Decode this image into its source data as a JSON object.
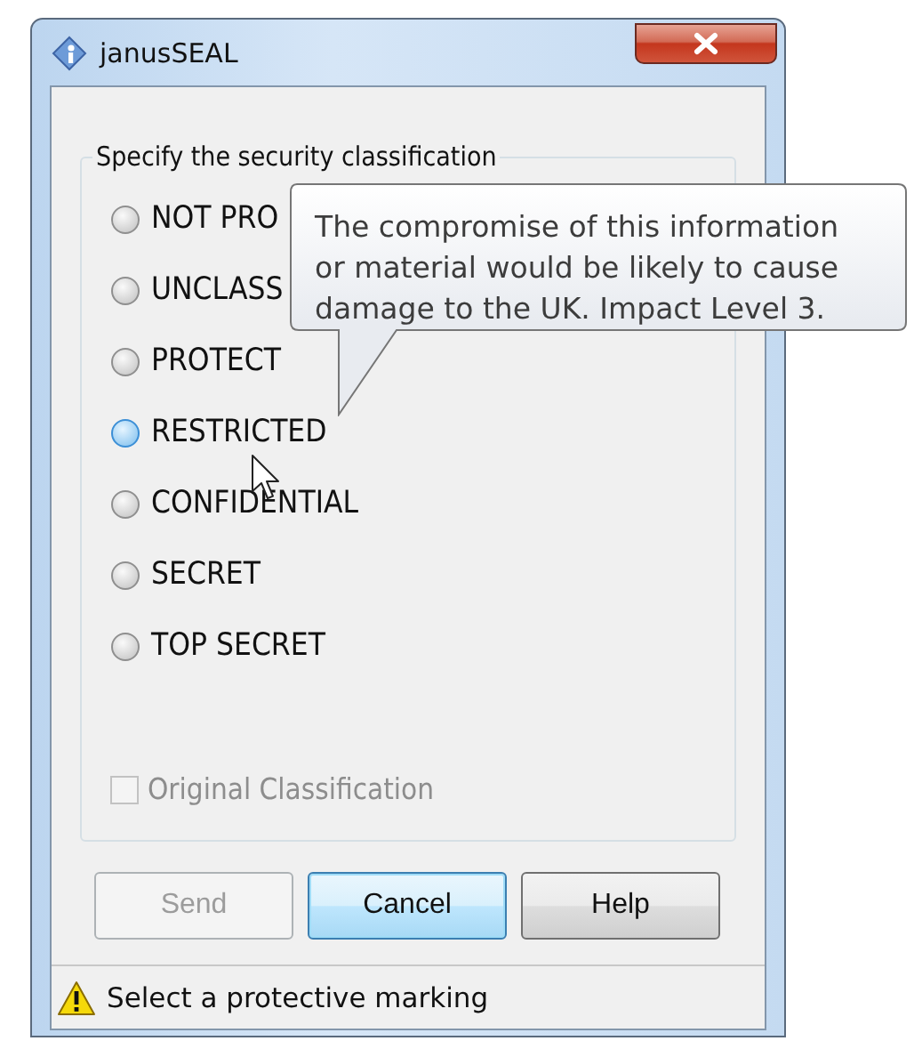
{
  "window": {
    "title": "janusSEAL"
  },
  "group": {
    "label": "Specify the security classification",
    "options": [
      {
        "label": "NOT PRO",
        "selected": false,
        "hovered": false
      },
      {
        "label": "UNCLASS",
        "selected": false,
        "hovered": false
      },
      {
        "label": "PROTECT",
        "selected": false,
        "hovered": false
      },
      {
        "label": "RESTRICTED",
        "selected": false,
        "hovered": true
      },
      {
        "label": "CONFIDENTIAL",
        "selected": false,
        "hovered": false
      },
      {
        "label": "SECRET",
        "selected": false,
        "hovered": false
      },
      {
        "label": "TOP SECRET",
        "selected": false,
        "hovered": false
      }
    ],
    "original_classification": {
      "label": "Original Classification",
      "checked": false,
      "disabled": true
    }
  },
  "tooltip": {
    "lines": [
      "The compromise of this information",
      "or material would be likely to cause",
      "damage to the UK. Impact Level 3."
    ]
  },
  "buttons": [
    {
      "label": "Send",
      "disabled": true,
      "default": false
    },
    {
      "label": "Cancel",
      "disabled": false,
      "default": true
    },
    {
      "label": "Help",
      "disabled": false,
      "default": false
    }
  ],
  "status_bar": {
    "kind": "warning",
    "text": "Select a protective marking"
  }
}
